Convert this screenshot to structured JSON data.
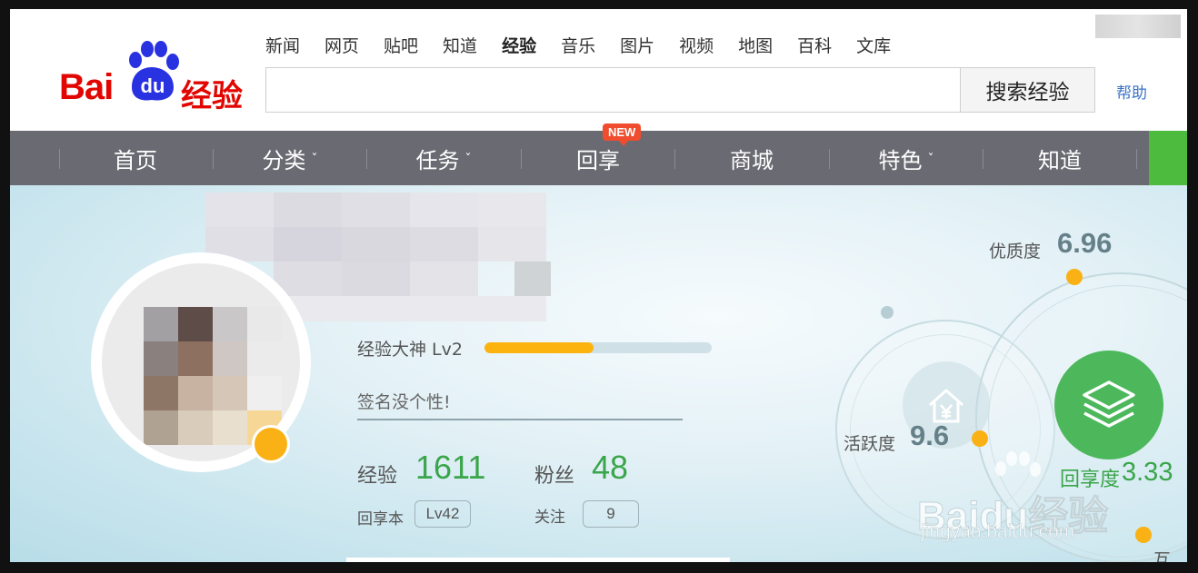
{
  "logo": {
    "bai": "Bai",
    "du": "du",
    "cn": "经验"
  },
  "topnav": [
    "新闻",
    "网页",
    "贴吧",
    "知道",
    "经验",
    "音乐",
    "图片",
    "视频",
    "地图",
    "百科",
    "文库"
  ],
  "search": {
    "placeholder": "",
    "button": "搜索经验"
  },
  "help": "帮助",
  "mainnav": {
    "items": [
      "首页",
      "分类",
      "任务",
      "回享",
      "商城",
      "特色",
      "知道"
    ],
    "new_badge": "NEW",
    "chevron": "ˇ"
  },
  "profile": {
    "level_label": "经验大神 Lv2",
    "level_progress": 0.48,
    "signature": "签名没个性!",
    "exp_label": "经验",
    "exp_value": "1611",
    "fans_label": "粉丝",
    "fans_value": "48",
    "huixiang_label": "回享本",
    "huixiang_level": "Lv42",
    "follow_label": "关注",
    "follow_value": "9"
  },
  "metrics": {
    "quality_label": "优质度",
    "quality_value": "6.96",
    "activity_label": "活跃度",
    "activity_value": "9.6",
    "share_label": "回享度",
    "share_value": "3.33",
    "partial_label": "互动"
  },
  "watermark": {
    "text": "Baidu经验",
    "url": "jingyan.baidu.com"
  },
  "colors": {
    "brand_red": "#e10601",
    "nav_bg": "#6a6a72",
    "green": "#4cb85b",
    "orange": "#f9b115",
    "link_blue": "#3b73c8"
  }
}
